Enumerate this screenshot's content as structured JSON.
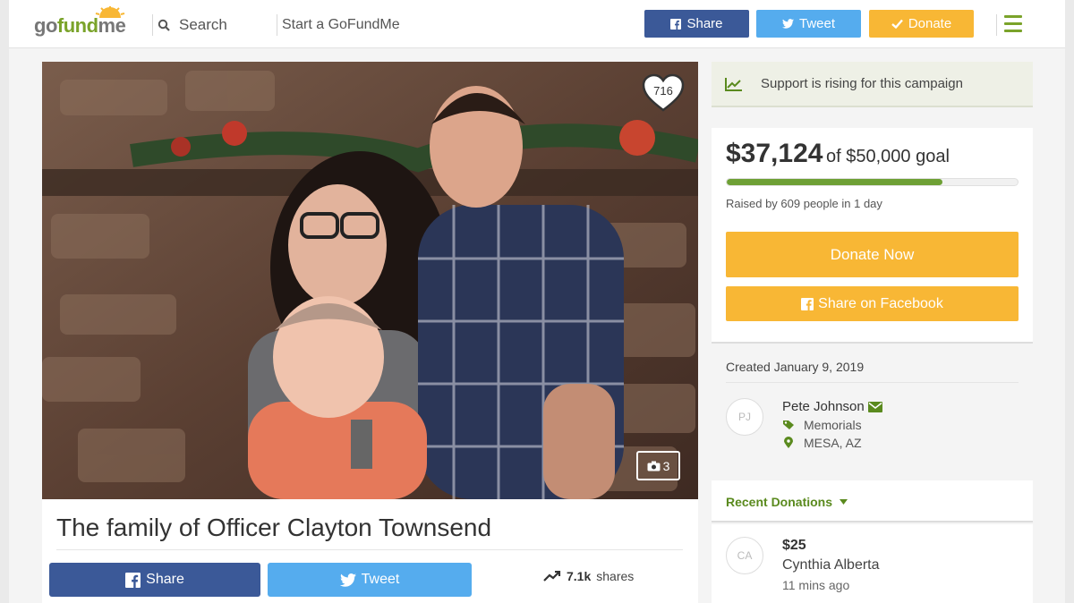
{
  "header": {
    "logo": {
      "go": "go",
      "fund": "fund",
      "me": "me"
    },
    "search_label": "Search",
    "start_label": "Start a GoFundMe",
    "share_label": "Share",
    "tweet_label": "Tweet",
    "donate_label": "Donate"
  },
  "campaign": {
    "title": "The family of Officer Clayton Townsend",
    "hearts": "716",
    "photo_count": "3",
    "share_label": "Share",
    "tweet_label": "Tweet",
    "share_count": "7.1k",
    "shares_suffix": "shares"
  },
  "sidebar": {
    "rising_text": "Support is rising for this campaign",
    "raised_amount": "$37,124",
    "goal_text": "of $50,000 goal",
    "progress_fraction": 0.7425,
    "raised_by": "Raised by 609 people in 1 day",
    "donate_now_label": "Donate Now",
    "share_facebook_label": "Share on Facebook",
    "created": "Created January 9, 2019",
    "organizer": {
      "initials": "PJ",
      "name": "Pete Johnson",
      "category": "Memorials",
      "location": "MESA, AZ"
    },
    "recent_donations_label": "Recent Donations",
    "donations": [
      {
        "initials": "CA",
        "amount": "$25",
        "name": "Cynthia Alberta",
        "time": "11 mins ago"
      }
    ]
  },
  "colors": {
    "brand_green": "#7aa32a",
    "facebook": "#3b5998",
    "twitter": "#55acee",
    "donate": "#f8b735"
  }
}
